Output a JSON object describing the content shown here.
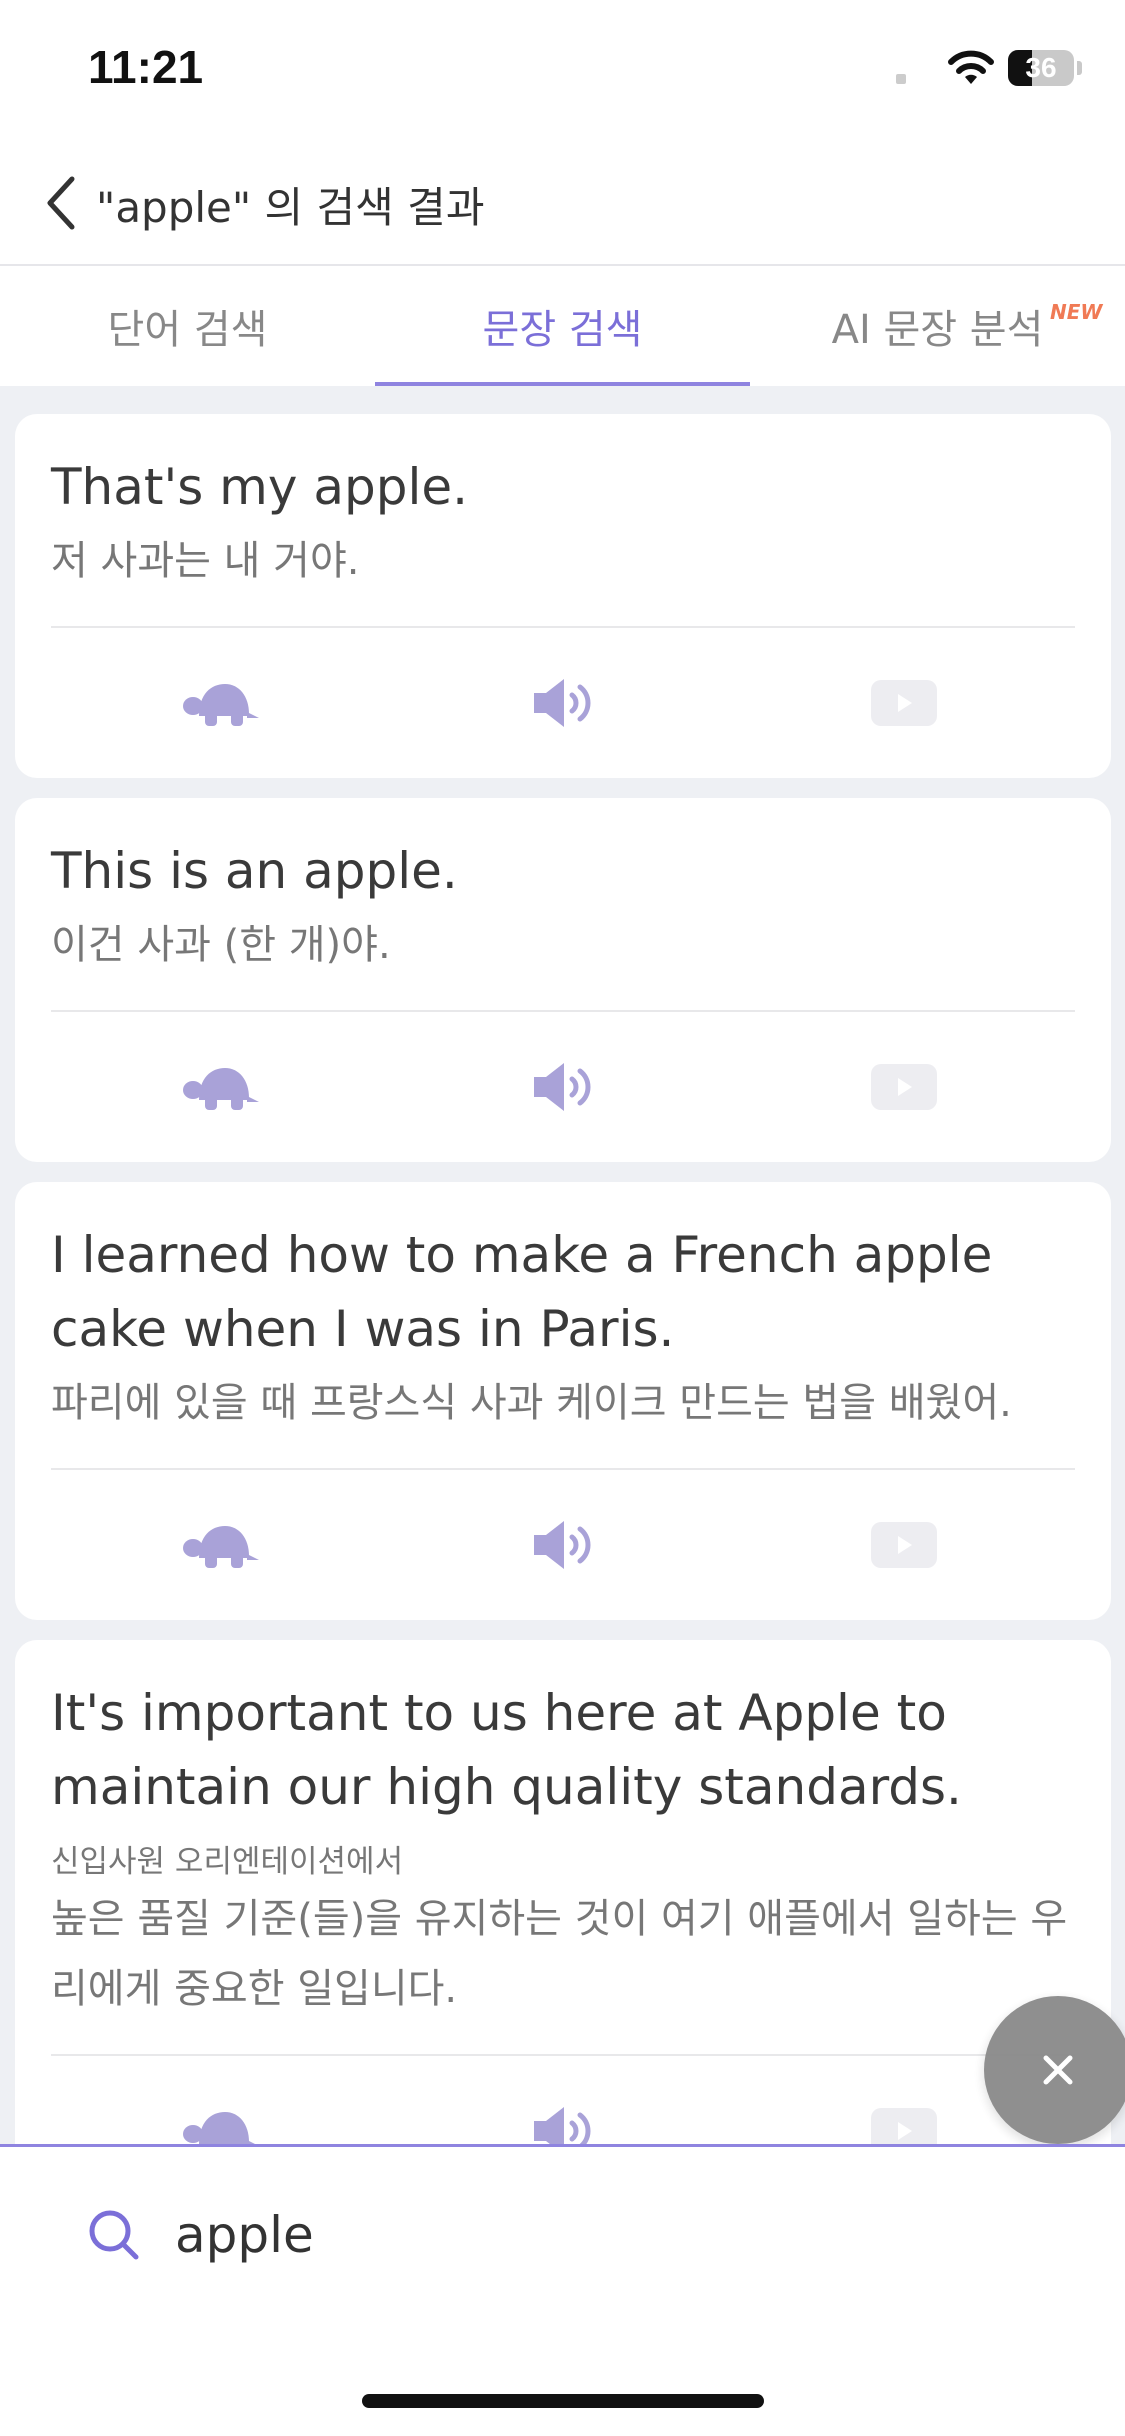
{
  "status_bar": {
    "time": "11:21",
    "battery_level": "36",
    "battery_fraction": 0.36
  },
  "header": {
    "title": "\"apple\" 의 검색 결과"
  },
  "tabs": [
    {
      "label": "단어 검색",
      "active": false
    },
    {
      "label": "문장 검색",
      "active": true
    },
    {
      "label": "AI 문장 분석",
      "active": false,
      "badge": "NEW"
    }
  ],
  "results": [
    {
      "en": "That's my apple.",
      "ko": "저 사과는 내 거야."
    },
    {
      "en": "This is an apple.",
      "ko": "이건 사과 (한 개)야."
    },
    {
      "en": "I learned how to make a French apple cake when I was in Paris.",
      "ko": "파리에 있을 때 프랑스식 사과 케이크 만드는 법을 배웠어."
    },
    {
      "en": "It's important to us here at Apple to maintain our high quality standards.",
      "context": "신입사원 오리엔테이션에서",
      "ko": "높은 품질 기준(들)을 유지하는 것이 여기 애플에서 일하는 우리에게 중요한 일입니다."
    }
  ],
  "search": {
    "value": "apple"
  },
  "colors": {
    "accent": "#7b6fd8",
    "icon": "#a9a2d8",
    "video_icon": "#ededf1"
  }
}
